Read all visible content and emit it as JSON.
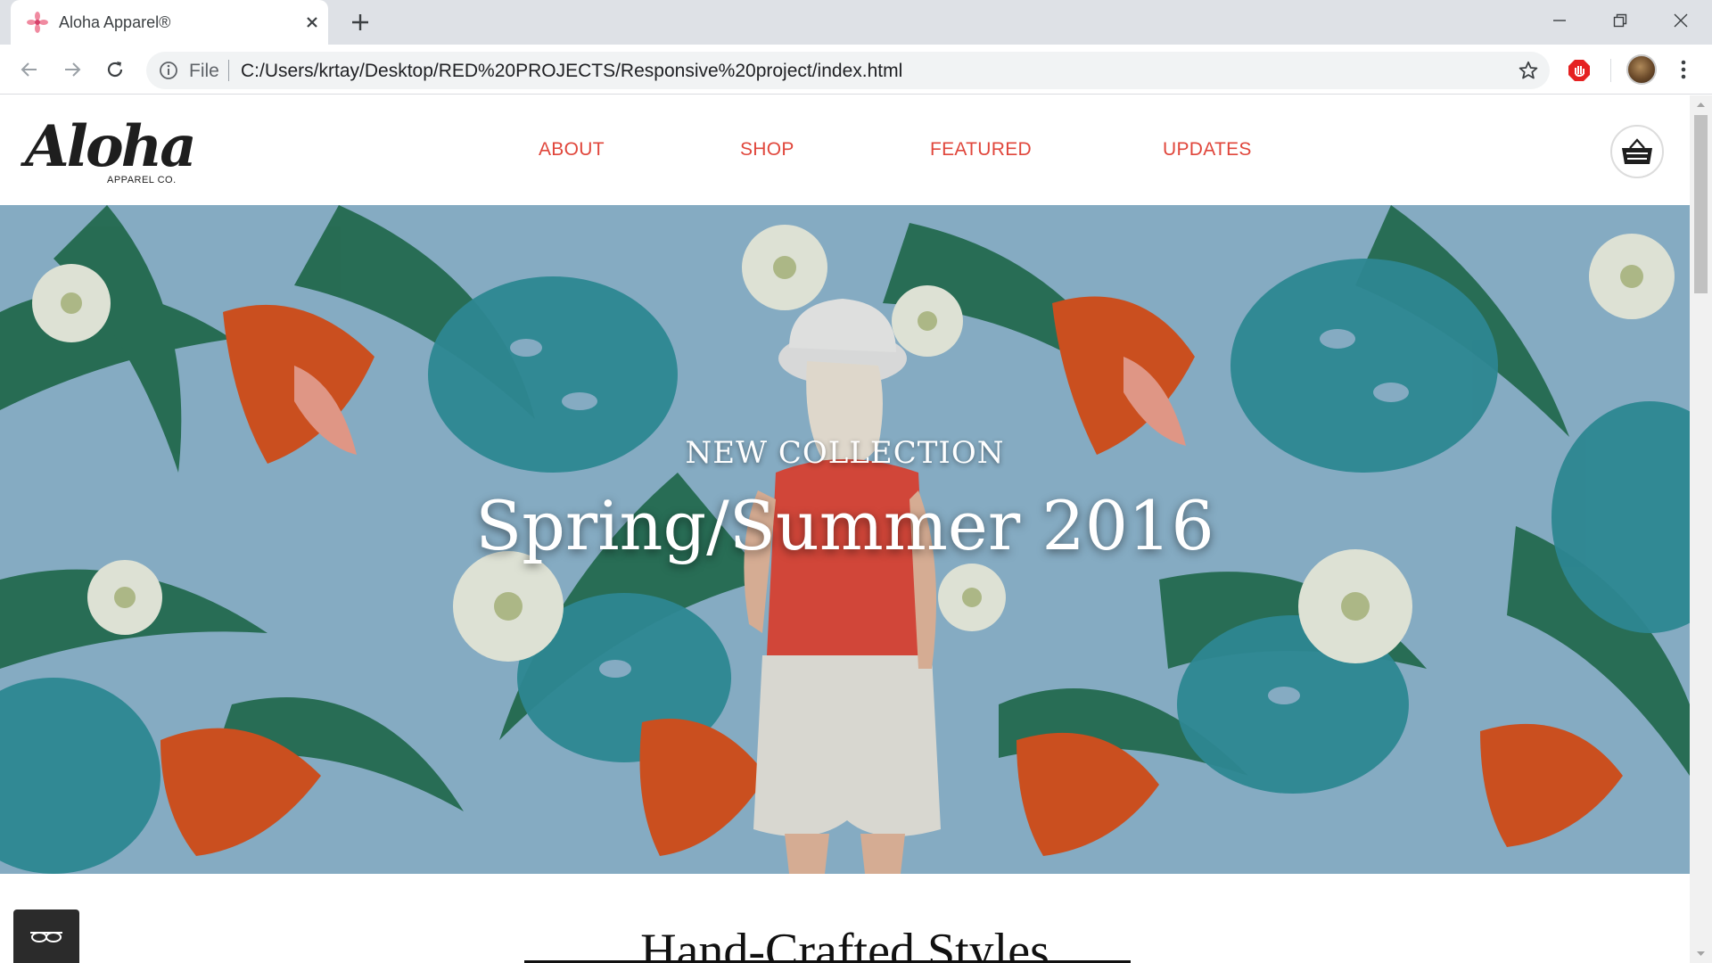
{
  "browser": {
    "tab_title": "Aloha Apparel®",
    "url_scheme": "File",
    "url": "C:/Users/krtay/Desktop/RED%20PROJECTS/Responsive%20project/index.html"
  },
  "site": {
    "logo_text": "Aloha",
    "logo_subtext": "APPAREL CO.",
    "nav": [
      {
        "label": "ABOUT"
      },
      {
        "label": "SHOP"
      },
      {
        "label": "FEATURED"
      },
      {
        "label": "UPDATES"
      }
    ],
    "accent_color": "#e0463b"
  },
  "hero": {
    "kicker": "NEW COLLECTION",
    "title": "Spring/Summer 2016"
  },
  "section": {
    "title": "Hand-Crafted Styles"
  },
  "icons": [
    "flower-favicon-icon",
    "close-icon",
    "plus-icon",
    "minimize-icon",
    "restore-icon",
    "window-close-icon",
    "back-arrow-icon",
    "forward-arrow-icon",
    "reload-icon",
    "info-icon",
    "star-icon",
    "adblock-icon",
    "more-vert-icon",
    "basket-icon",
    "glasses-icon"
  ]
}
